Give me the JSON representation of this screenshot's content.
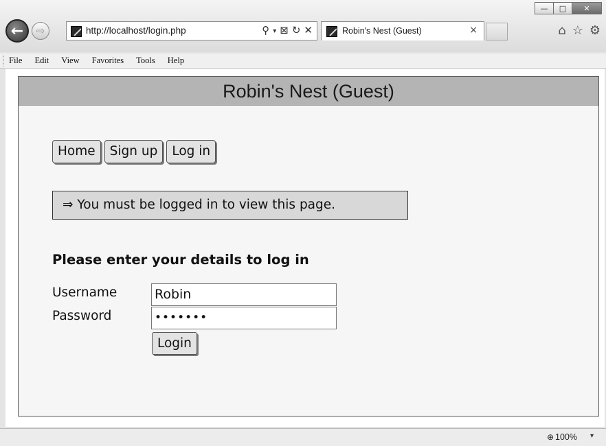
{
  "browser": {
    "address_url": "http://localhost/login.php",
    "tab_title": "Robin's Nest (Guest)",
    "tab_close": "×",
    "menu": [
      "File",
      "Edit",
      "View",
      "Favorites",
      "Tools",
      "Help"
    ],
    "window_controls": {
      "minimize": "—",
      "maximize": "□",
      "close": "✕"
    },
    "zoom_level": "100%"
  },
  "site": {
    "header": "Robin's Nest (Guest)",
    "nav": [
      "Home",
      "Sign up",
      "Log in"
    ],
    "notice": "⇒ You must be logged in to view this page.",
    "form": {
      "heading": "Please enter your details to log in",
      "username_label": "Username",
      "password_label": "Password",
      "username_value": "Robin",
      "password_value": "•••••••",
      "submit_label": "Login"
    }
  },
  "icons": {
    "back": "back-arrow-icon",
    "forward": "forward-arrow-icon",
    "search": "search-icon",
    "compat": "compatibility-view-icon",
    "refresh": "refresh-icon",
    "stop": "stop-icon",
    "home": "home-icon",
    "favorites": "favorites-star-icon",
    "tools": "gear-icon",
    "zoom": "zoom-icon"
  }
}
